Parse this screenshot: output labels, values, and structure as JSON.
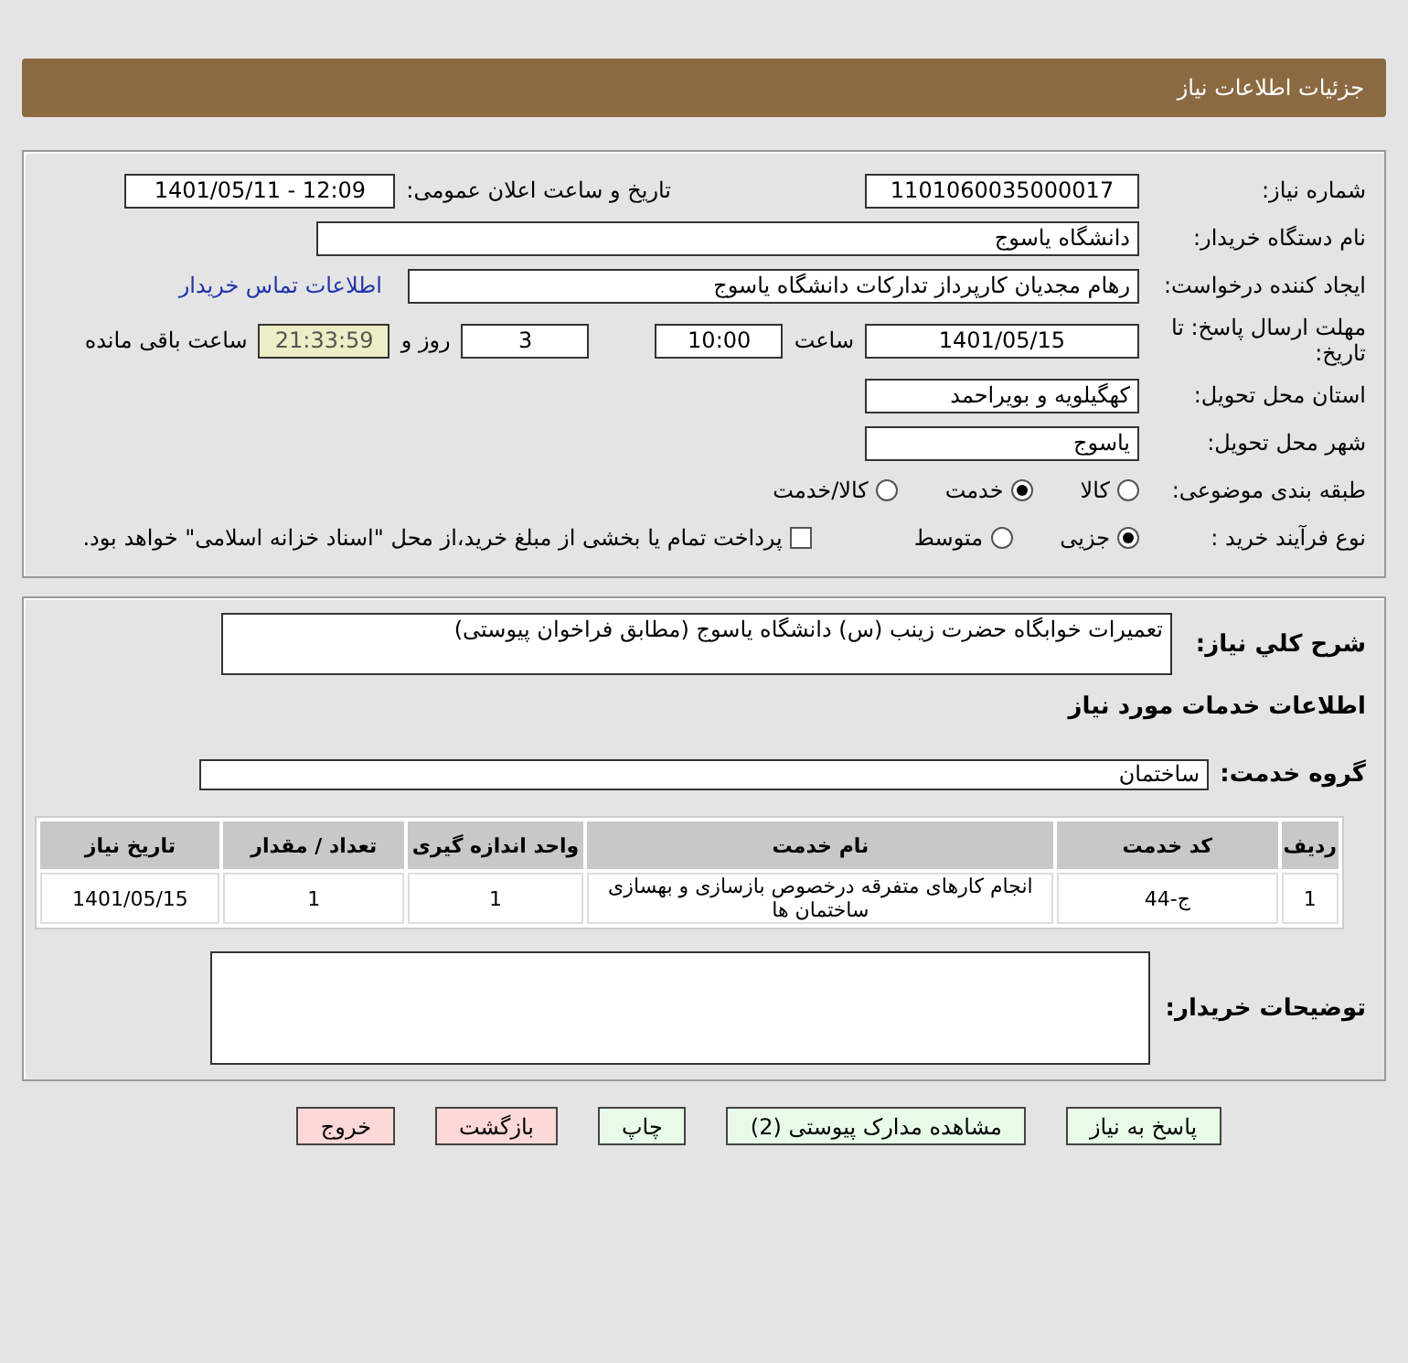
{
  "header": {
    "title": "جزئیات اطلاعات نیاز"
  },
  "details": {
    "need_number": {
      "label": "شماره نیاز:",
      "value": "1101060035000017"
    },
    "announce": {
      "label": "تاریخ و ساعت اعلان عمومی:",
      "value": "1401/05/11 - 12:09"
    },
    "buyer": {
      "label": "نام دستگاه خریدار:",
      "value": "دانشگاه یاسوج"
    },
    "creator": {
      "label": "ایجاد کننده درخواست:",
      "value": "رهام مجدیان کارپرداز تدارکات دانشگاه یاسوج",
      "link": "اطلاعات تماس خریدار"
    },
    "deadline": {
      "label": "مهلت ارسال پاسخ: تا تاریخ:",
      "date": "1401/05/15",
      "time_label": "ساعت",
      "time": "10:00",
      "days": "3",
      "days_label": "روز و",
      "remaining": "21:33:59",
      "remaining_label": "ساعت باقی مانده"
    },
    "province": {
      "label": "استان محل تحویل:",
      "value": "کهگیلویه و بویراحمد"
    },
    "city": {
      "label": "شهر محل تحویل:",
      "value": "یاسوج"
    },
    "category": {
      "label": "طبقه بندی موضوعی:",
      "options": [
        {
          "label": "کالا",
          "selected": false
        },
        {
          "label": "خدمت",
          "selected": true
        },
        {
          "label": "کالا/خدمت",
          "selected": false
        }
      ]
    },
    "process": {
      "label": "نوع فرآیند خرید :",
      "options": [
        {
          "label": "جزیی",
          "selected": true
        },
        {
          "label": "متوسط",
          "selected": false
        }
      ],
      "payment": {
        "label": "پرداخت تمام یا بخشی از مبلغ خرید،از محل \"اسناد خزانه اسلامی\" خواهد بود.",
        "checked": false
      }
    }
  },
  "summary": {
    "label": "شرح کلي نياز:",
    "value": "تعمیرات خوابگاه حضرت زینب (س) دانشگاه یاسوج (مطابق فراخوان پیوستی)",
    "services_heading": "اطلاعات خدمات مورد نیاز",
    "service_group": {
      "label": "گروه خدمت:",
      "value": "ساختمان"
    },
    "table": {
      "columns": [
        "ردیف",
        "کد خدمت",
        "نام خدمت",
        "واحد اندازه گیری",
        "تعداد / مقدار",
        "تاریخ نیاز"
      ],
      "rows": [
        [
          "1",
          "ج-44",
          "انجام کارهای متفرقه درخصوص بازسازی و بهسازی ساختمان ها",
          "1",
          "1",
          "1401/05/15"
        ]
      ]
    },
    "notes": {
      "label": "توضیحات خریدار:"
    }
  },
  "buttons": [
    {
      "label": "پاسخ به نیاز",
      "kind": "normal"
    },
    {
      "label": "مشاهده مدارک پیوستی (2)",
      "kind": "normal"
    },
    {
      "label": "چاپ",
      "kind": "normal"
    },
    {
      "label": "بازگشت",
      "kind": "danger"
    },
    {
      "label": "خروج",
      "kind": "danger"
    }
  ]
}
